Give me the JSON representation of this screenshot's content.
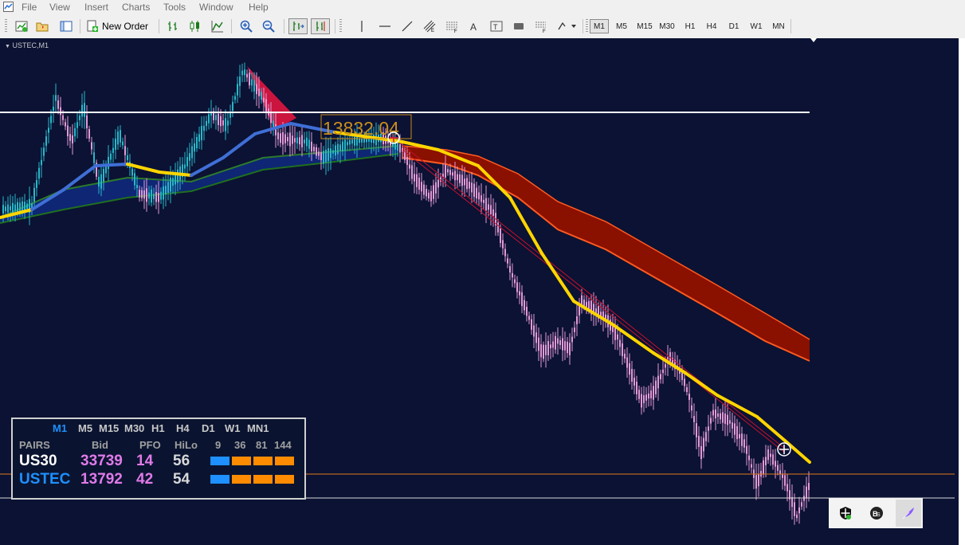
{
  "menu": [
    "File",
    "View",
    "Insert",
    "Charts",
    "Tools",
    "Window",
    "Help"
  ],
  "toolbar": {
    "new_order_label": "New Order",
    "timeframes": [
      "M1",
      "M5",
      "M15",
      "M30",
      "H1",
      "H4",
      "D1",
      "W1",
      "MN"
    ],
    "active_timeframe": "M1"
  },
  "chart": {
    "symbol_label": "USTEC,M1",
    "price_marker": "13832.04",
    "colors": {
      "background": "#0b1233",
      "bull_candle": "#29b7c9",
      "bear_candle": "#e39ad6",
      "ma_fast": "#ffd500",
      "ma_fast_up": "#3f6fd6",
      "ribbon_upper": "#8a1000",
      "ribbon_lower": "#ff5a1f",
      "band": "#0f2a80",
      "hline": "#ffffff",
      "price_line": "#e07a1e"
    }
  },
  "dashboard": {
    "timeframes": [
      "M1",
      "M5",
      "M15",
      "M30",
      "H1",
      "H4",
      "D1",
      "W1",
      "MN1"
    ],
    "active_timeframe": "M1",
    "headers": {
      "pairs": "PAIRS",
      "bid": "Bid",
      "pfo": "PFO",
      "hilo": "HiLo",
      "p9": "9",
      "p36": "36",
      "p81": "81",
      "p144": "144"
    },
    "rows": [
      {
        "pair": "US30",
        "bid": "33739",
        "pfo": "14",
        "hilo": "56",
        "pair_color": "#ffffff",
        "bar_colors": [
          "#1e90ff",
          "#ff8c00",
          "#ff8c00",
          "#ff8c00"
        ]
      },
      {
        "pair": "USTEC",
        "bid": "13792",
        "pfo": "42",
        "hilo": "54",
        "pair_color": "#1e90ff",
        "bar_colors": [
          "#1e90ff",
          "#ff8c00",
          "#ff8c00",
          "#ff8c00"
        ]
      }
    ]
  },
  "tray_icons": [
    "shield-icon",
    "bs-icon",
    "feather-icon"
  ]
}
